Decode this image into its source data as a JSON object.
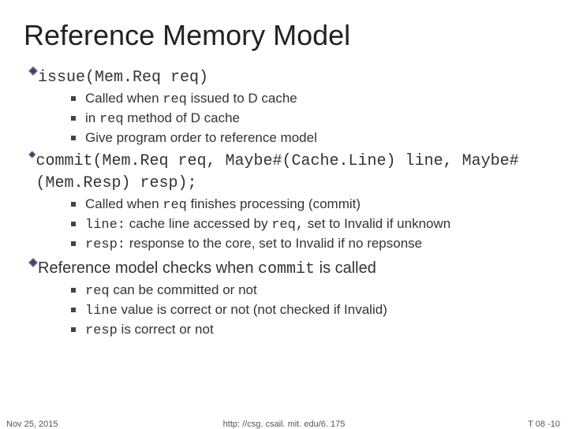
{
  "title": "Reference Memory Model",
  "sections": [
    {
      "head_pre": "issue(Mem.Req req)",
      "head_post": "",
      "subs": [
        {
          "pre": "Called when ",
          "mono1": "req",
          "mid": " issued to D cache",
          "mono2": "",
          "post": ""
        },
        {
          "pre": "in ",
          "mono1": "req",
          "mid": " method of D cache",
          "mono2": "",
          "post": ""
        },
        {
          "pre": "Give program order to reference model",
          "mono1": "",
          "mid": "",
          "mono2": "",
          "post": ""
        }
      ]
    },
    {
      "head_pre": "commit(Mem.Req req, Maybe#(Cache.Line) line, Maybe#(Mem.Resp) resp);",
      "head_post": "",
      "subs": [
        {
          "pre": "Called when ",
          "mono1": "req",
          "mid": " finishes processing (commit)",
          "mono2": "",
          "post": ""
        },
        {
          "pre": "",
          "mono1": "line:",
          "mid": " cache line accessed by ",
          "mono2": "req,",
          "post": " set to Invalid if unknown"
        },
        {
          "pre": "",
          "mono1": "resp:",
          "mid": " response to the core, set to Invalid if no repsonse",
          "mono2": "",
          "post": ""
        }
      ]
    },
    {
      "head_pre": "",
      "head_post": "Reference model checks when commit is called",
      "subs": [
        {
          "pre": "",
          "mono1": "req",
          "mid": " can be committed or not",
          "mono2": "",
          "post": ""
        },
        {
          "pre": "",
          "mono1": "line",
          "mid": " value is correct or not (not checked if Invalid)",
          "mono2": "",
          "post": ""
        },
        {
          "pre": "",
          "mono1": "resp",
          "mid": " is correct or not",
          "mono2": "",
          "post": ""
        }
      ]
    }
  ],
  "footer": {
    "date": "Nov 25, 2015",
    "url": "http: //csg. csail. mit. edu/6. 175",
    "page": "T 08 -10"
  }
}
